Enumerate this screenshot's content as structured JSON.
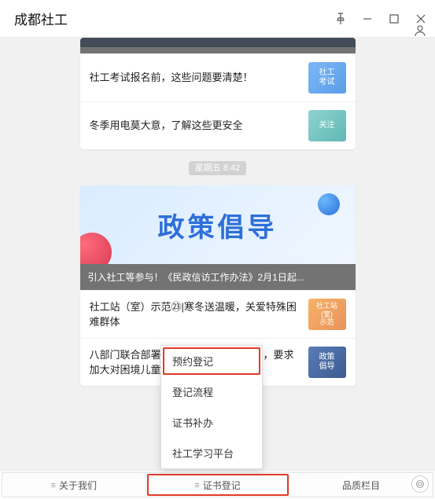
{
  "title": "成都社工",
  "timestamp": "星期五 8:42",
  "card1": {
    "header": "",
    "rows": [
      {
        "text": "社工考试报名前，这些问题要清楚！",
        "thumb": "社工\n考试"
      },
      {
        "text": "冬季用电莫大意，了解这些更安全",
        "thumb": "关注"
      }
    ]
  },
  "hero_text": "政策倡导",
  "card2": {
    "header": "引入社工等参与！《民政信访工作办法》2月1日起...",
    "rows": [
      {
        "text": "社工站（室）示范㉓|寒冬送温暖，关爱特殊困难群体",
        "thumb": "社工站\n(室)\n示范"
      },
      {
        "text": "八部门联合部署开展寒假儿童关爱工作，要求加大对困境儿童关爱帮扶、教育助力度",
        "thumb": "政策\n倡导"
      }
    ]
  },
  "nav": {
    "about": "关于我们",
    "cert": "证书登记",
    "quality": "品质栏目"
  },
  "popup": {
    "book": "预约登记",
    "flow": "登记流程",
    "reissue": "证书补办",
    "study": "社工学习平台"
  }
}
